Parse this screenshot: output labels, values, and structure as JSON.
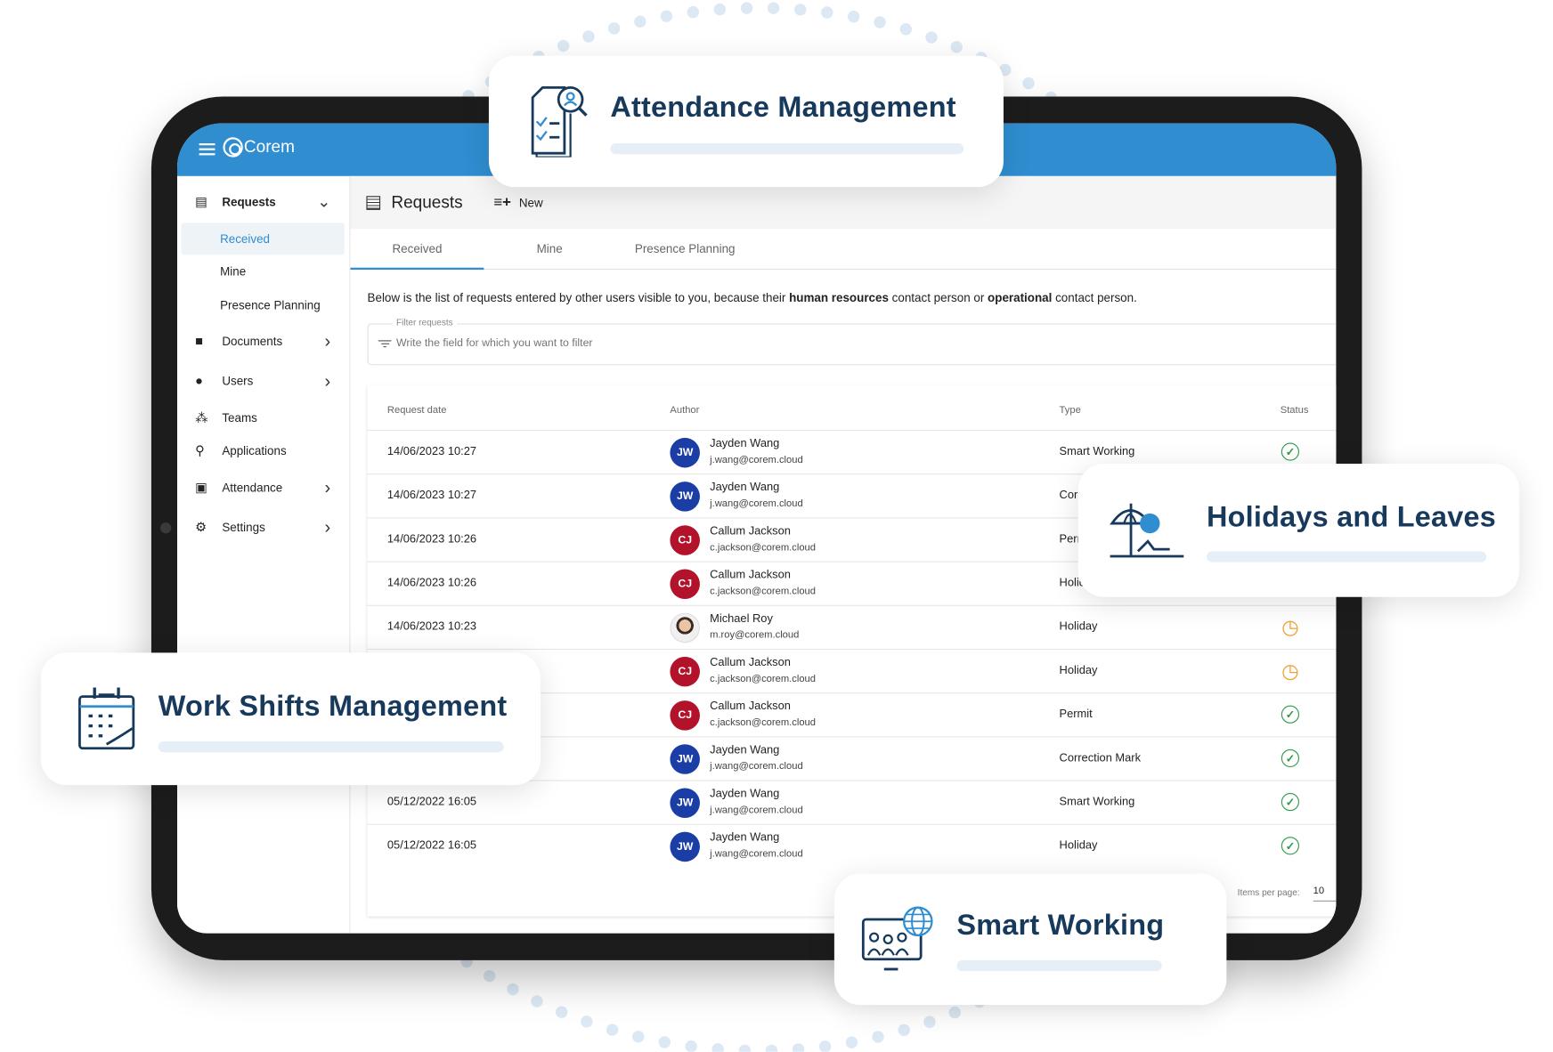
{
  "app": {
    "brand": "Corem",
    "accent": "#2f8dd0"
  },
  "sidebar": {
    "items": [
      {
        "label": "Requests",
        "icon": "list-icon",
        "expanded": true,
        "children": [
          {
            "label": "Received",
            "active": true
          },
          {
            "label": "Mine"
          },
          {
            "label": "Presence Planning"
          }
        ]
      },
      {
        "label": "Documents",
        "icon": "folder-icon"
      },
      {
        "label": "Users",
        "icon": "user-icon"
      },
      {
        "label": "Teams",
        "icon": "team-icon"
      },
      {
        "label": "Applications",
        "icon": "user-search-icon"
      },
      {
        "label": "Attendance",
        "icon": "badge-icon"
      },
      {
        "label": "Settings",
        "icon": "gear-icon"
      }
    ]
  },
  "main": {
    "title": "Requests",
    "new_label": "New",
    "tabs": [
      {
        "label": "Received",
        "active": true
      },
      {
        "label": "Mine"
      },
      {
        "label": "Presence Planning"
      }
    ],
    "description": {
      "pre": "Below is the list of requests entered by other users visible to you, because their ",
      "b1": "human resources",
      "mid": " contact person or ",
      "b2": "operational",
      "post": " contact person."
    },
    "filter": {
      "label": "Filter requests",
      "placeholder": "Write the field for which you want to filter"
    },
    "table": {
      "columns": [
        "Request date",
        "Author",
        "Type",
        "Status"
      ],
      "rows": [
        {
          "date": "14/06/2023 10:27",
          "initials": "JW",
          "name": "Jayden Wang",
          "email": "j.wang@corem.cloud",
          "type": "Smart Working",
          "status": "approved"
        },
        {
          "date": "14/06/2023 10:27",
          "initials": "JW",
          "name": "Jayden Wang",
          "email": "j.wang@corem.cloud",
          "type": "Correction Mark",
          "status": "approved"
        },
        {
          "date": "14/06/2023 10:26",
          "initials": "CJ",
          "name": "Callum Jackson",
          "email": "c.jackson@corem.cloud",
          "type": "Permit",
          "status": "approved"
        },
        {
          "date": "14/06/2023 10:26",
          "initials": "CJ",
          "name": "Callum Jackson",
          "email": "c.jackson@corem.cloud",
          "type": "Holiday",
          "status": "approved"
        },
        {
          "date": "14/06/2023 10:23",
          "initials": "",
          "name": "Michael Roy",
          "email": "m.roy@corem.cloud",
          "type": "Holiday",
          "status": "pending"
        },
        {
          "date": "",
          "initials": "CJ",
          "name": "Callum Jackson",
          "email": "c.jackson@corem.cloud",
          "type": "Holiday",
          "status": "pending"
        },
        {
          "date": "",
          "initials": "CJ",
          "name": "Callum Jackson",
          "email": "c.jackson@corem.cloud",
          "type": "Permit",
          "status": "approved"
        },
        {
          "date": "",
          "initials": "JW",
          "name": "Jayden Wang",
          "email": "j.wang@corem.cloud",
          "type": "Correction Mark",
          "status": "approved"
        },
        {
          "date": "05/12/2022 16:05",
          "initials": "JW",
          "name": "Jayden Wang",
          "email": "j.wang@corem.cloud",
          "type": "Smart Working",
          "status": "approved"
        },
        {
          "date": "05/12/2022 16:05",
          "initials": "JW",
          "name": "Jayden Wang",
          "email": "j.wang@corem.cloud",
          "type": "Holiday",
          "status": "approved"
        }
      ],
      "items_per_page_label": "Items per page:",
      "items_per_page": "10"
    }
  },
  "colors": {
    "JW": "#1a3ea6",
    "CJ": "#b3122b",
    "approved": "#2e9a4a",
    "pending": "#f0a030",
    "card_title": "#173a5c"
  },
  "cards": [
    {
      "title": "Attendance Management",
      "icon": "attendance-document-icon"
    },
    {
      "title": "Holidays and Leaves",
      "icon": "beach-umbrella-icon"
    },
    {
      "title": "Work Shifts Management",
      "icon": "calendar-icon"
    },
    {
      "title": "Smart Working",
      "icon": "remote-team-globe-icon"
    }
  ]
}
